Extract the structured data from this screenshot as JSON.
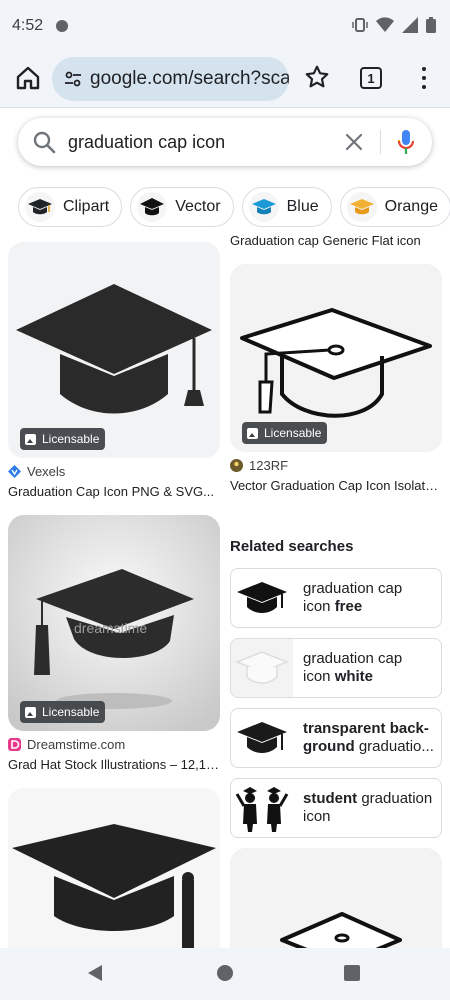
{
  "status_bar": {
    "time": "4:52"
  },
  "browser": {
    "url": "google.com/search?sca_",
    "tab_count": "1"
  },
  "search": {
    "query": "graduation cap icon"
  },
  "chips": [
    {
      "label": "Clipart"
    },
    {
      "label": "Vector"
    },
    {
      "label": "Blue"
    },
    {
      "label": "Orange"
    }
  ],
  "results": {
    "top_partial_title": "Graduation cap Generic Flat icon",
    "items": [
      {
        "source": "Vexels",
        "title": "Graduation Cap Icon PNG & SVG...",
        "badge": "Licensable"
      },
      {
        "source": "123RF",
        "title": "Vector Graduation Cap Icon Isolate...",
        "badge": "Licensable"
      },
      {
        "source": "Dreamstime.com",
        "title": "Grad Hat Stock Illustrations – 12,19...",
        "badge": "Licensable",
        "watermark": "dreamstime"
      }
    ]
  },
  "related": {
    "heading": "Related searches",
    "items": [
      {
        "line1": "graduation cap",
        "line2_plain": "icon ",
        "line2_bold": "free"
      },
      {
        "line1": "graduation cap",
        "line2_plain": "icon ",
        "line2_bold": "white"
      },
      {
        "line1_bold": "transparent back-",
        "line2_bold": "ground",
        "line2_plain": " graduatio..."
      },
      {
        "line1_bold": "student",
        "line1_plain": " graduation",
        "line2_plain": "icon"
      }
    ]
  },
  "colors": {
    "chrome_bg": "#f1f4f9",
    "url_pill": "#d5e3ef",
    "chip_blue": "#1a9ad6",
    "chip_orange": "#f2b134"
  }
}
